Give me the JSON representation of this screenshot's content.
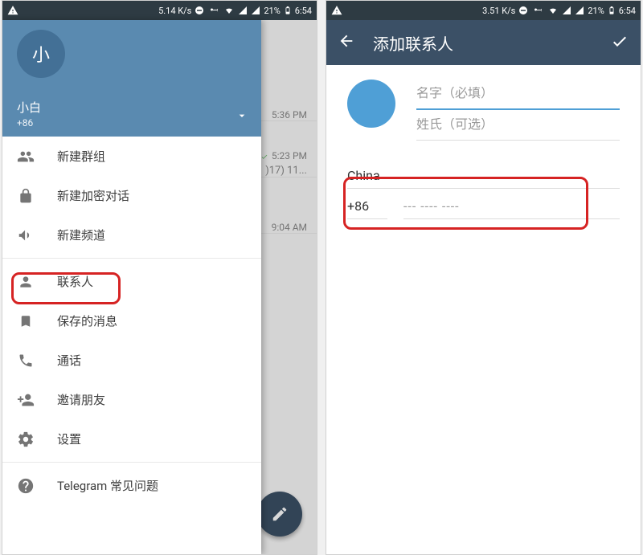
{
  "statusbar": {
    "speed_left": "5.14 K/s",
    "speed_right": "3.51 K/s",
    "battery_pct": "21%",
    "clock": "6:54"
  },
  "left": {
    "drawer": {
      "avatar_letter": "小",
      "display_name": "小白",
      "phone_number": "+86",
      "items": [
        {
          "icon": "group",
          "label": "新建群组"
        },
        {
          "icon": "lock",
          "label": "新建加密对话"
        },
        {
          "icon": "megaphone",
          "label": "新建频道"
        },
        {
          "icon": "contact",
          "label": "联系人"
        },
        {
          "icon": "bookmark",
          "label": "保存的消息"
        },
        {
          "icon": "phone",
          "label": "通话"
        },
        {
          "icon": "invite",
          "label": "邀请朋友"
        },
        {
          "icon": "gear",
          "label": "设置"
        },
        {
          "icon": "help",
          "label": "Telegram 常见问题"
        }
      ]
    },
    "chatlist": {
      "rows": [
        {
          "time": "5:36 PM",
          "sub": ""
        },
        {
          "time": "5:23 PM",
          "sub": ")17) 11..."
        },
        {
          "time": "9:04 AM",
          "sub": ""
        }
      ]
    }
  },
  "right": {
    "title": "添加联系人",
    "first_name_placeholder": "名字（必填）",
    "last_name_placeholder": "姓氏（可选）",
    "country": "China",
    "country_code": "+86",
    "phone_mask": "--- ---- ----"
  }
}
